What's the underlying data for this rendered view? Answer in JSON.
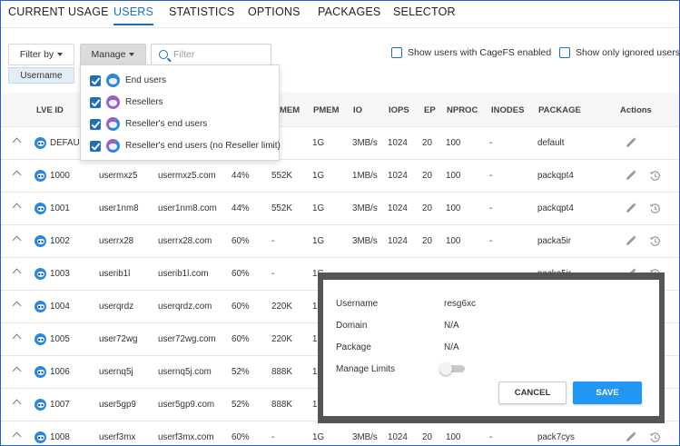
{
  "tabs": [
    "CURRENT USAGE",
    "USERS",
    "STATISTICS",
    "OPTIONS",
    "PACKAGES",
    "SELECTOR"
  ],
  "active_tab": "USERS",
  "toolbar": {
    "filter_by_label": "Filter by",
    "manage_label": "Manage",
    "filter_placeholder": "Filter",
    "show_cagefs_label": "Show users with CageFS enabled",
    "show_ignored_label": "Show only ignored users",
    "filter_chip": "Username"
  },
  "manage_menu": [
    {
      "label": "End users",
      "checked": true,
      "icon": "end-user-icon"
    },
    {
      "label": "Resellers",
      "checked": true,
      "icon": "reseller-icon"
    },
    {
      "label": "Reseller's end users",
      "checked": true,
      "icon": "reseller-end-user-icon"
    },
    {
      "label": "Reseller's end users (no Reseller limit)",
      "checked": true,
      "icon": "reseller-end-user-icon"
    }
  ],
  "table": {
    "headers": {
      "lve_id": "LVE ID",
      "vmem": "MEM",
      "pmem": "PMEM",
      "io": "IO",
      "iops": "IOPS",
      "ep": "EP",
      "nproc": "NPROC",
      "inodes": "INODES",
      "package": "PACKAGE",
      "actions": "Actions"
    },
    "rows": [
      {
        "id": "DEFAULT",
        "user": "",
        "domain": "",
        "speed": "",
        "vmem": "",
        "pmem": "1G",
        "io": "3MB/s",
        "iops": "1024",
        "ep": "20",
        "nproc": "100",
        "inodes": "-",
        "package": "default"
      },
      {
        "id": "1000",
        "user": "usermxz5",
        "domain": "usermxz5.com",
        "speed": "44%",
        "vmem": "552K",
        "pmem": "1G",
        "io": "1MB/s",
        "iops": "1024",
        "ep": "20",
        "nproc": "100",
        "inodes": "-",
        "package": "packqpt4"
      },
      {
        "id": "1001",
        "user": "user1nm8",
        "domain": "user1nm8.com",
        "speed": "44%",
        "vmem": "552K",
        "pmem": "1G",
        "io": "3MB/s",
        "iops": "1024",
        "ep": "20",
        "nproc": "100",
        "inodes": "-",
        "package": "packqpt4"
      },
      {
        "id": "1002",
        "user": "userrx28",
        "domain": "userrx28.com",
        "speed": "60%",
        "vmem": "-",
        "pmem": "1G",
        "io": "3MB/s",
        "iops": "1024",
        "ep": "20",
        "nproc": "100",
        "inodes": "-",
        "package": "packa5ir"
      },
      {
        "id": "1003",
        "user": "userib1l",
        "domain": "userib1l.com",
        "speed": "60%",
        "vmem": "-",
        "pmem": "1G",
        "io": "",
        "iops": "",
        "ep": "",
        "nproc": "",
        "inodes": "",
        "package": "packa5ir"
      },
      {
        "id": "1004",
        "user": "userqrdz",
        "domain": "userqrdz.com",
        "speed": "60%",
        "vmem": "220K",
        "pmem": "1G",
        "io": "",
        "iops": "",
        "ep": "",
        "nproc": "",
        "inodes": "",
        "package": ""
      },
      {
        "id": "1005",
        "user": "user72wg",
        "domain": "user72wg.com",
        "speed": "60%",
        "vmem": "220K",
        "pmem": "1G",
        "io": "",
        "iops": "",
        "ep": "",
        "nproc": "",
        "inodes": "",
        "package": ""
      },
      {
        "id": "1006",
        "user": "usernq5j",
        "domain": "usernq5j.com",
        "speed": "52%",
        "vmem": "888K",
        "pmem": "1G",
        "io": "",
        "iops": "",
        "ep": "",
        "nproc": "",
        "inodes": "",
        "package": ""
      },
      {
        "id": "1007",
        "user": "user5gp9",
        "domain": "user5gp9.com",
        "speed": "52%",
        "vmem": "888K",
        "pmem": "1G",
        "io": "",
        "iops": "",
        "ep": "",
        "nproc": "",
        "inodes": "",
        "package": ""
      },
      {
        "id": "1008",
        "user": "userf3mx",
        "domain": "userf3mx.com",
        "speed": "60%",
        "vmem": "-",
        "pmem": "1G",
        "io": "3MB/s",
        "iops": "1024",
        "ep": "20",
        "nproc": "100",
        "inodes": "-",
        "package": "pack7cys"
      }
    ]
  },
  "modal": {
    "username_label": "Username",
    "username_value": "resg6xc",
    "domain_label": "Domain",
    "domain_value": "N/A",
    "package_label": "Package",
    "package_value": "N/A",
    "manage_limits_label": "Manage Limits",
    "manage_limits_on": false,
    "cancel_label": "CANCEL",
    "save_label": "SAVE"
  },
  "colors": {
    "accent": "#1d6fb8",
    "save": "#2196f3",
    "reseller": "#9a5fc4"
  }
}
